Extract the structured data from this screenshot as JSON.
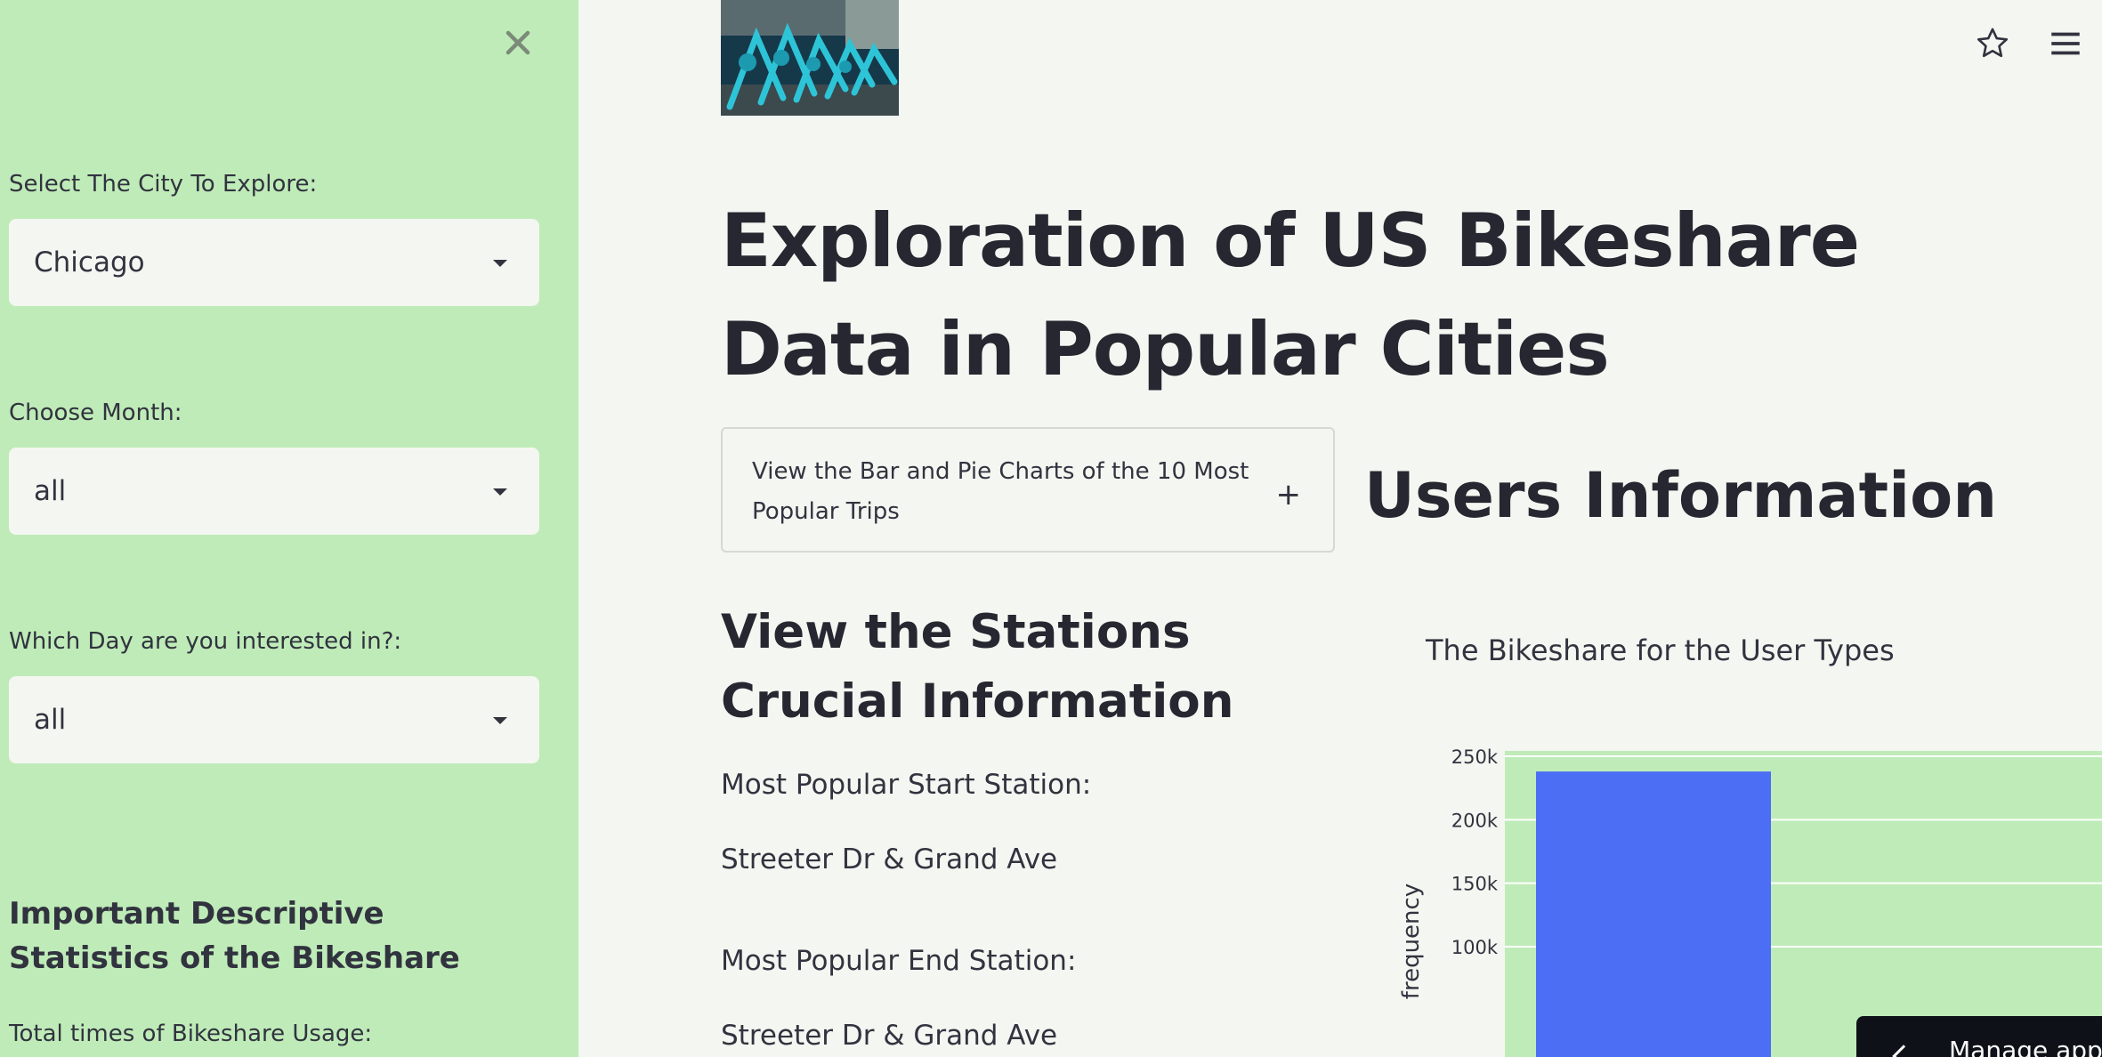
{
  "sidebar": {
    "city_label": "Select The City To Explore:",
    "city_value": "Chicago",
    "month_label": "Choose Month:",
    "month_value": "all",
    "day_label": "Which Day are you interested in?:",
    "day_value": "all",
    "stats_heading": "Important Descriptive Statistics of the Bikeshare",
    "total_usage_label": "Total times of Bikeshare Usage:"
  },
  "main": {
    "title": "Exploration of US Bikeshare Data in Popular Cities",
    "expander_label": "View the Bar and Pie Charts of the 10 Most Popular Trips",
    "expander_icon": "+",
    "users_title": "Users Information",
    "stations_title": "View the Stations Crucial Information",
    "start_station_label": "Most Popular Start Station:",
    "start_station_value": "Streeter Dr & Grand Ave",
    "end_station_label": "Most Popular End Station:",
    "end_station_value": "Streeter Dr & Grand Ave"
  },
  "toolbar": {
    "star_icon": "star-icon",
    "menu_icon": "hamburger-menu-icon",
    "manage_app_label": "Manage app"
  },
  "colors": {
    "sidebar_bg": "#bfebb8",
    "page_bg": "#f4f6f1",
    "bar": "#4c6ef5",
    "plot_bg": "#bfebb8"
  },
  "chart_data": {
    "type": "bar",
    "title": "The Bikeshare for the User Types",
    "ylabel": "frequency",
    "xlabel": "",
    "categories": [
      ""
    ],
    "values": [
      238000
    ],
    "ylim": [
      75000,
      260000
    ],
    "yticks": [
      100000,
      150000,
      200000,
      250000
    ],
    "ytick_labels": [
      "100k",
      "150k",
      "200k",
      "250k"
    ],
    "grid": true
  }
}
